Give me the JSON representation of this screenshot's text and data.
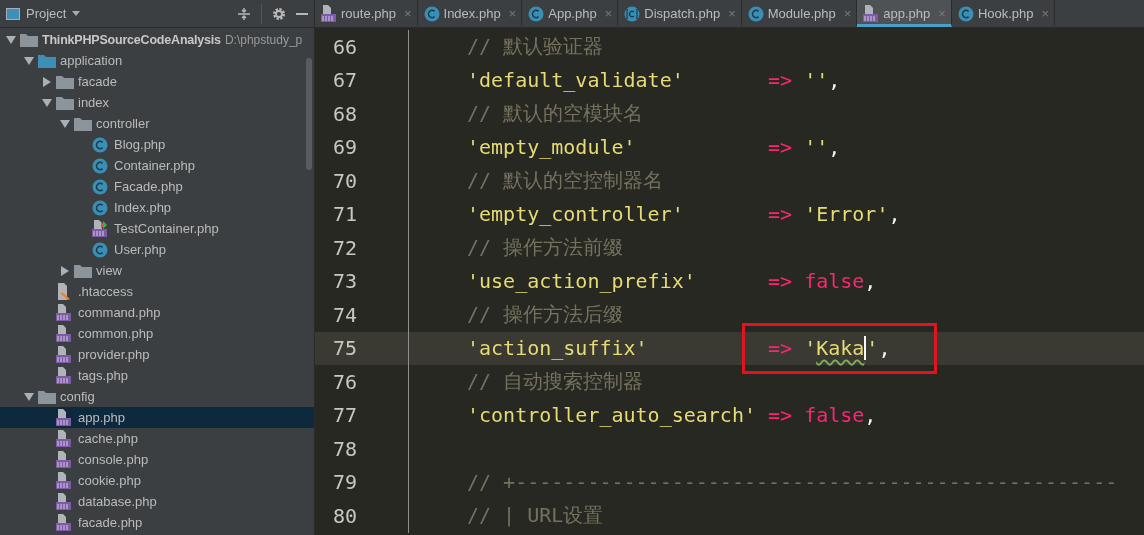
{
  "project_panel": {
    "title": "Project",
    "tree": [
      {
        "label": "ThinkPHPSourceCodeAnalysis",
        "path": "D:\\phpstudy_p",
        "kind": "folder",
        "expanded": true,
        "selected": false,
        "children": [
          {
            "label": "application",
            "kind": "source-folder",
            "expanded": true,
            "selected": false,
            "children": [
              {
                "label": "facade",
                "kind": "folder",
                "expanded": false,
                "selected": false
              },
              {
                "label": "index",
                "kind": "folder",
                "expanded": true,
                "selected": false,
                "children": [
                  {
                    "label": "controller",
                    "kind": "folder",
                    "expanded": true,
                    "selected": false,
                    "children": [
                      {
                        "label": "Blog.php",
                        "kind": "class",
                        "selected": false
                      },
                      {
                        "label": "Container.php",
                        "kind": "class",
                        "selected": false
                      },
                      {
                        "label": "Facade.php",
                        "kind": "class",
                        "selected": false
                      },
                      {
                        "label": "Index.php",
                        "kind": "class",
                        "selected": false
                      },
                      {
                        "label": "TestContainer.php",
                        "kind": "php-test",
                        "selected": false
                      },
                      {
                        "label": "User.php",
                        "kind": "class",
                        "selected": false
                      }
                    ]
                  },
                  {
                    "label": "view",
                    "kind": "folder",
                    "expanded": false,
                    "selected": false
                  }
                ]
              },
              {
                "label": ".htaccess",
                "kind": "htaccess",
                "selected": false
              },
              {
                "label": "command.php",
                "kind": "php",
                "selected": false
              },
              {
                "label": "common.php",
                "kind": "php",
                "selected": false
              },
              {
                "label": "provider.php",
                "kind": "php",
                "selected": false
              },
              {
                "label": "tags.php",
                "kind": "php",
                "selected": false
              }
            ]
          },
          {
            "label": "config",
            "kind": "folder",
            "expanded": true,
            "selected": false,
            "children": [
              {
                "label": "app.php",
                "kind": "php",
                "selected": true
              },
              {
                "label": "cache.php",
                "kind": "php",
                "selected": false
              },
              {
                "label": "console.php",
                "kind": "php",
                "selected": false
              },
              {
                "label": "cookie.php",
                "kind": "php",
                "selected": false
              },
              {
                "label": "database.php",
                "kind": "php",
                "selected": false
              },
              {
                "label": "facade.php",
                "kind": "php",
                "selected": false
              }
            ]
          }
        ]
      }
    ]
  },
  "tabs": [
    {
      "label": "route.php",
      "kind": "php",
      "selected": false,
      "close": "×"
    },
    {
      "label": "Index.php",
      "kind": "class",
      "selected": false,
      "close": "×"
    },
    {
      "label": "App.php",
      "kind": "class",
      "selected": false,
      "close": "×"
    },
    {
      "label": "Dispatch.php",
      "kind": "abstract-class",
      "selected": false,
      "close": "×"
    },
    {
      "label": "Module.php",
      "kind": "class",
      "selected": false,
      "close": "×"
    },
    {
      "label": "app.php",
      "kind": "php",
      "selected": true,
      "close": "×"
    },
    {
      "label": "Hook.php",
      "kind": "class",
      "selected": false,
      "close": "×"
    }
  ],
  "editor": {
    "lines": [
      {
        "number": "66",
        "kind": "comment",
        "text": "// 默认验证器",
        "current": false
      },
      {
        "number": "67",
        "kind": "entry",
        "key": "'default_validate'",
        "arrow": "=>",
        "value": [
          {
            "kind": "string",
            "text": "''"
          },
          {
            "kind": "punct",
            "text": ","
          }
        ],
        "current": false,
        "annotated": false
      },
      {
        "number": "68",
        "kind": "comment",
        "text": "// 默认的空模块名",
        "current": false
      },
      {
        "number": "69",
        "kind": "entry",
        "key": "'empty_module'",
        "arrow": "=>",
        "value": [
          {
            "kind": "string",
            "text": "''"
          },
          {
            "kind": "punct",
            "text": ","
          }
        ],
        "current": false,
        "annotated": false
      },
      {
        "number": "70",
        "kind": "comment",
        "text": "// 默认的空控制器名",
        "current": false
      },
      {
        "number": "71",
        "kind": "entry",
        "key": "'empty_controller'",
        "arrow": "=>",
        "value": [
          {
            "kind": "string",
            "text": "'Error'"
          },
          {
            "kind": "punct",
            "text": ","
          }
        ],
        "current": false,
        "annotated": false
      },
      {
        "number": "72",
        "kind": "comment",
        "text": "// 操作方法前缀",
        "current": false
      },
      {
        "number": "73",
        "kind": "entry",
        "key": "'use_action_prefix'",
        "arrow": "=>",
        "value": [
          {
            "kind": "keyword",
            "text": "false"
          },
          {
            "kind": "punct",
            "text": ","
          }
        ],
        "current": false,
        "annotated": false
      },
      {
        "number": "74",
        "kind": "comment",
        "text": "// 操作方法后缀",
        "current": false
      },
      {
        "number": "75",
        "kind": "entry",
        "key": "'action_suffix'",
        "arrow": "=>",
        "value": [
          {
            "kind": "string",
            "text": "'"
          },
          {
            "kind": "string",
            "text": "Kaka",
            "typo": true,
            "caret": true
          },
          {
            "kind": "string",
            "text": "'"
          },
          {
            "kind": "punct",
            "text": ","
          }
        ],
        "current": true,
        "annotated": true
      },
      {
        "number": "76",
        "kind": "comment",
        "text": "// 自动搜索控制器",
        "current": false
      },
      {
        "number": "77",
        "kind": "entry",
        "key": "'controller_auto_search'",
        "arrow": "=>",
        "value": [
          {
            "kind": "keyword",
            "text": "false"
          },
          {
            "kind": "punct",
            "text": ","
          }
        ],
        "current": false,
        "annotated": false
      },
      {
        "number": "78",
        "kind": "blank",
        "current": false
      },
      {
        "number": "79",
        "kind": "comment",
        "text": "// +--------------------------------------------------",
        "current": false
      },
      {
        "number": "80",
        "kind": "comment",
        "text": "// | URL设置",
        "current": false
      }
    ]
  }
}
